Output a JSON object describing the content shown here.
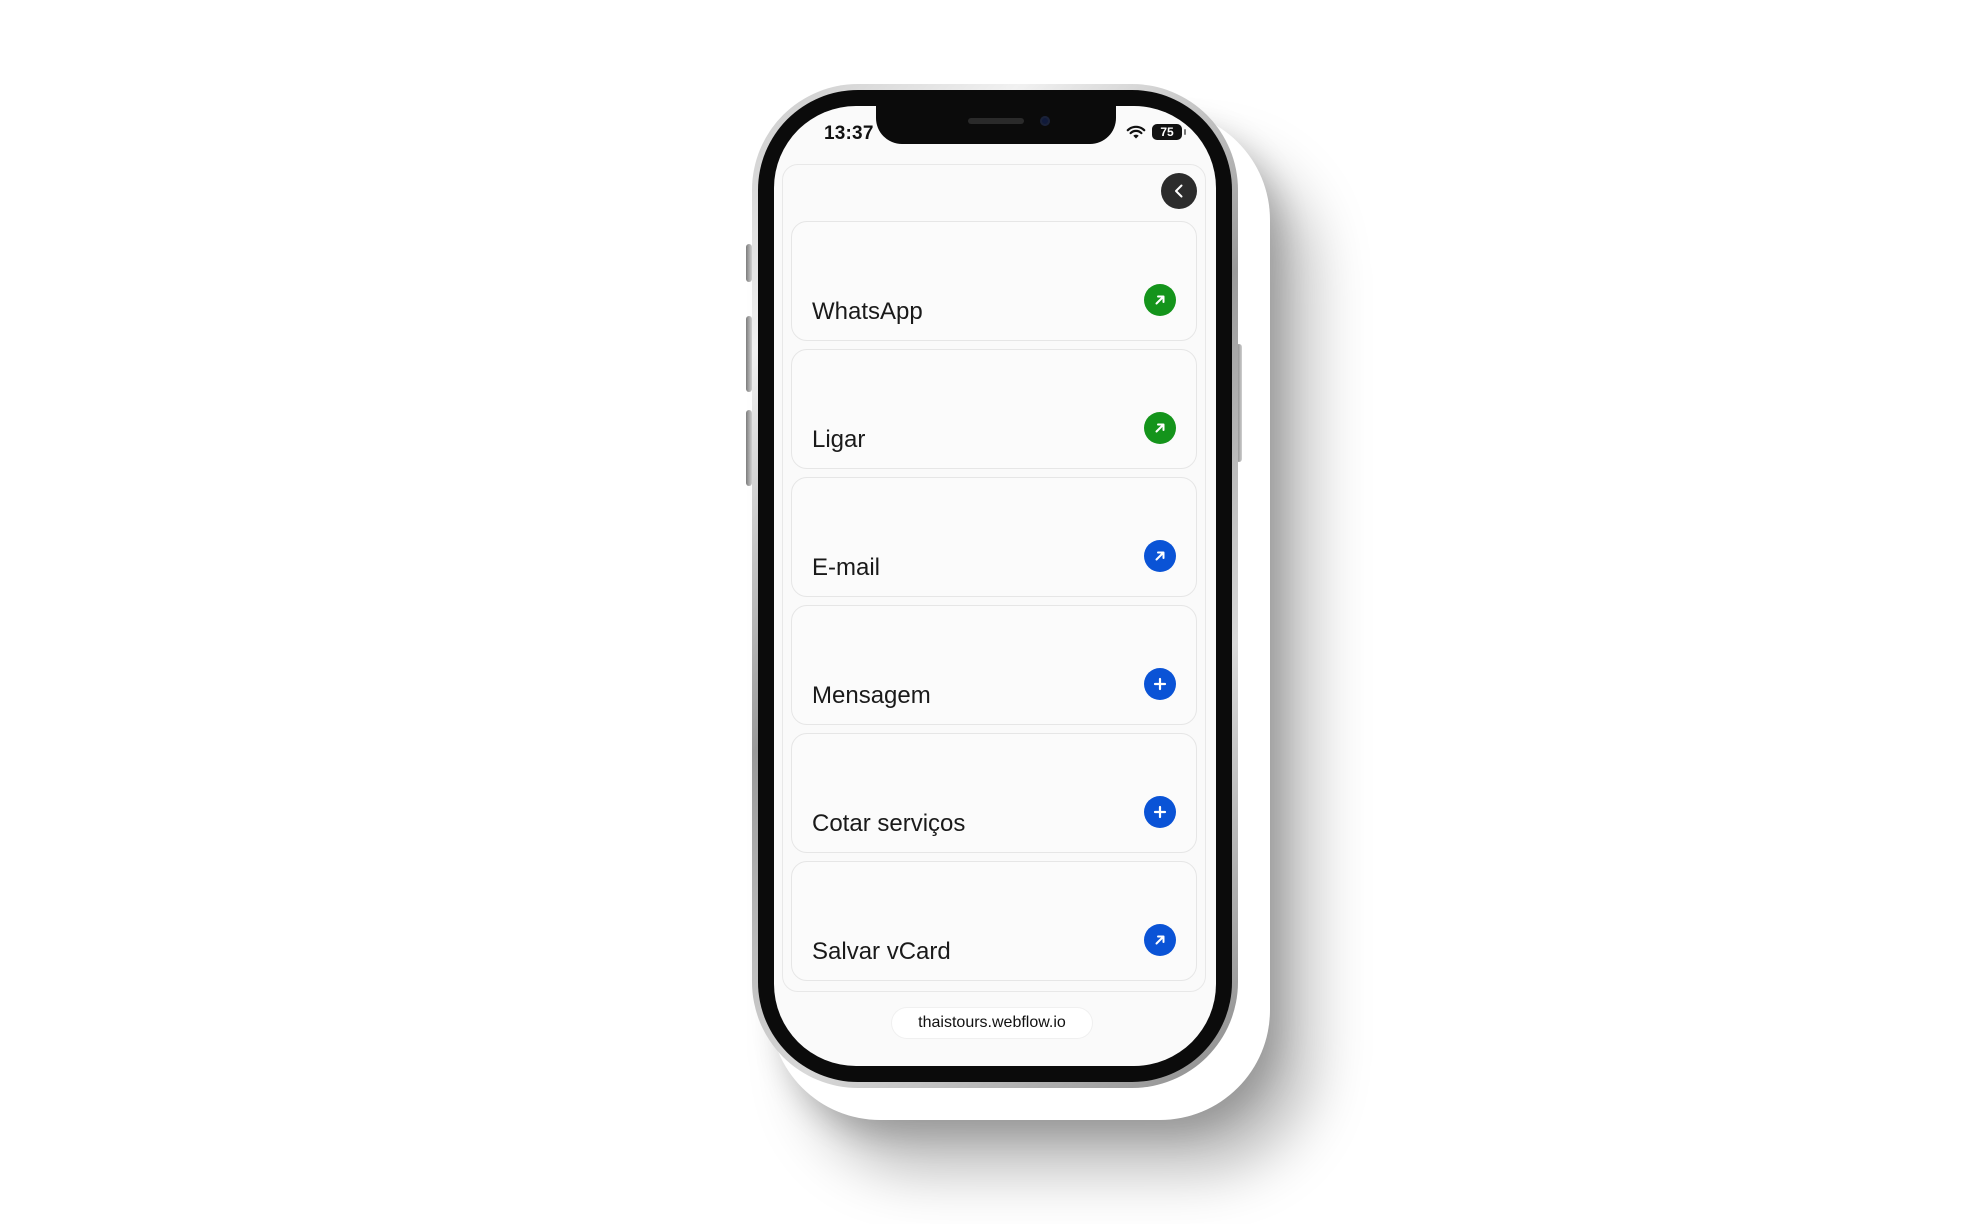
{
  "status_bar": {
    "time": "13:37",
    "battery": "75",
    "icons": [
      "wifi-icon",
      "battery-icon"
    ]
  },
  "header": {
    "back_icon": "chevron-left-icon"
  },
  "actions": [
    {
      "label": "WhatsApp",
      "icon": "arrow-up-right-icon",
      "color": "#14941b"
    },
    {
      "label": "Ligar",
      "icon": "arrow-up-right-icon",
      "color": "#14941b"
    },
    {
      "label": "E-mail",
      "icon": "arrow-up-right-icon",
      "color": "#0a53d6"
    },
    {
      "label": "Mensagem",
      "icon": "plus-icon",
      "color": "#0a53d6"
    },
    {
      "label": "Cotar serviços",
      "icon": "plus-icon",
      "color": "#0a53d6"
    },
    {
      "label": "Salvar vCard",
      "icon": "arrow-up-right-icon",
      "color": "#0a53d6"
    }
  ],
  "browser": {
    "url": "thaistours.webflow.io"
  }
}
